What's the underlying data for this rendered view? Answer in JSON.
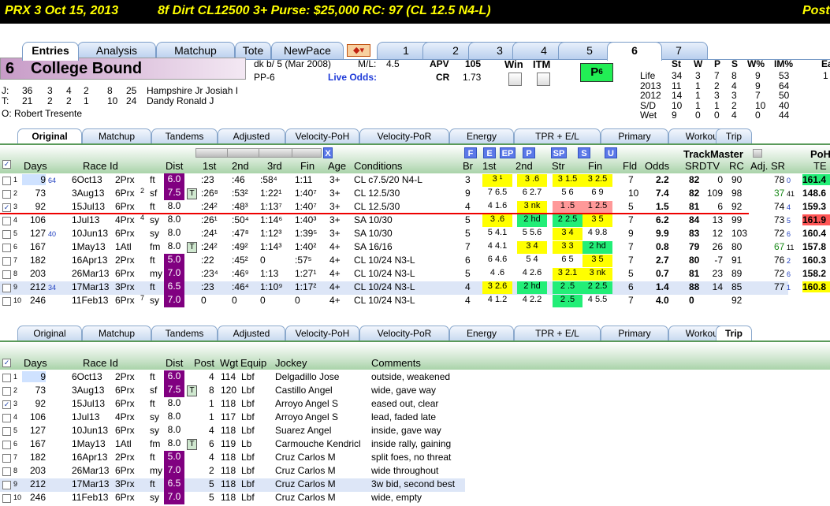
{
  "topbar": {
    "race": "PRX  3   Oct 15, 2013",
    "conditions": "8f  Dirt   CL12500  3+   Purse: $25,000   RC: 97  (CL 12.5 N4-L)",
    "right": "Post"
  },
  "main_tabs": [
    "Entries",
    "Analysis",
    "Matchup",
    "Tote",
    "NewPace",
    "1",
    "2",
    "3",
    "4",
    "5",
    "6",
    "7"
  ],
  "horse": {
    "number": "6",
    "name": "College Bound",
    "breed": "dk b/  5  (Mar 2008)",
    "ml_label": "M/L:",
    "ml": "4.5",
    "pp": "PP-6",
    "live_odds": "Live Odds:",
    "apv_label": "APV",
    "apv": "105",
    "cr_label": "CR",
    "cr": "1.73",
    "win": "Win",
    "itm": "ITM",
    "p_badge": "P",
    "p_sub": "6"
  },
  "jockey": {
    "label": "J:",
    "stats": [
      "36",
      "3",
      "4",
      "2",
      "8",
      "25"
    ],
    "name": "Hampshire Jr Josiah I"
  },
  "trainer": {
    "label": "T:",
    "stats": [
      "21",
      "2",
      "2",
      "1",
      "10",
      "24"
    ],
    "name": "Dandy Ronald J"
  },
  "owner": {
    "label": "O:",
    "name": "Robert Tresente"
  },
  "record": {
    "headers": [
      "St",
      "W",
      "P",
      "S",
      "W%",
      "IM%",
      "Ea"
    ],
    "rows": [
      [
        "Life",
        "34",
        "3",
        "7",
        "8",
        "9",
        "53",
        "1"
      ],
      [
        "2013",
        "11",
        "1",
        "2",
        "4",
        "9",
        "64",
        ""
      ],
      [
        "2012",
        "14",
        "1",
        "3",
        "3",
        "7",
        "50",
        ""
      ],
      [
        "S/D",
        "10",
        "1",
        "1",
        "2",
        "10",
        "40",
        ""
      ],
      [
        "Wet",
        "9",
        "0",
        "0",
        "4",
        "0",
        "44",
        ""
      ]
    ]
  },
  "sub_tabs": [
    "Original",
    "Matchup",
    "Tandems",
    "Adjusted",
    "Velocity-PoH",
    "Velocity-PoR",
    "Energy",
    "TPR + E/L",
    "Primary",
    "Workouts",
    "Trip"
  ],
  "pp_headers": {
    "days": "Days",
    "raceid": "Race Id",
    "dist": "Dist",
    "c1": "1st",
    "c2": "2nd",
    "c3": "3rd",
    "fin": "Fin",
    "age": "Age",
    "cond": "Conditions",
    "br": "Br",
    "first": "1st",
    "second": "2nd",
    "str": "Str",
    "fin2": "Fin",
    "fld": "Fld",
    "odds": "Odds",
    "srdtv": "SRDTV",
    "rc": "RC",
    "trackmaster": "TrackMaster",
    "adj": "Adj. SR",
    "poh": "PoH",
    "te": "TE",
    "btn_f": "F",
    "btn_e": "E",
    "btn_ep": "EP",
    "btn_p": "P",
    "btn_sp": "SP",
    "btn_s": "S",
    "btn_u": "U",
    "btn_x": "X"
  },
  "pp_rows": [
    {
      "n": "1",
      "days": "9",
      "dsub": "64",
      "date": "6Oct13",
      "race": "2Prx",
      "surf": "ft",
      "dist": "6.0",
      "c1": ":23",
      "c2": ":46",
      "c3": ":58⁴",
      "fin": "1:11",
      "age": "3+",
      "cond": "CL c7.5/20 N4-L",
      "br": "3",
      "p1": "3 ¹",
      "p2": "3 .6",
      "str": "3 1.5",
      "fin2": "3 2.5",
      "fld": "7",
      "odds": "2.2",
      "sr": "82",
      "dtv": "0",
      "rc": "90",
      "adj": "78",
      "adjs": "0",
      "te": "161.4",
      "checked": false
    },
    {
      "n": "2",
      "days": "73",
      "dsub": "",
      "date": "3Aug13",
      "race": "6Prx",
      "surf": "sf",
      "sup": "2",
      "dist": "7.5",
      "t": true,
      "c1": ":26⁸",
      "c2": ":53²",
      "c3": "1:22¹",
      "fin": "1:40⁷",
      "age": "3+",
      "cond": "CL 12.5/30",
      "br": "9",
      "p1": "7 6.5",
      "p2": "6 2.7",
      "str": "5 6",
      "fin2": "6 9",
      "fld": "10",
      "odds": "7.4",
      "sr": "82",
      "dtv": "109",
      "rc": "98",
      "adj": "37",
      "adj2": "41",
      "te": "148.6",
      "checked": false
    },
    {
      "n": "3",
      "days": "92",
      "dsub": "",
      "date": "15Jul13",
      "race": "6Prx",
      "surf": "ft",
      "dist": "8.0",
      "c1": ":24²",
      "c2": ":48³",
      "c3": "1:13⁷",
      "fin": "1:40⁷",
      "age": "3+",
      "cond": "CL 12.5/30",
      "br": "4",
      "p1": "4 1.6",
      "p2": "3 nk",
      "str": "1 .5",
      "fin2": "1 2.5",
      "fld": "5",
      "odds": "1.5",
      "sr": "81",
      "dtv": "6",
      "rc": "92",
      "adj": "74",
      "adjs": "4",
      "te": "159.3",
      "checked": true
    },
    {
      "n": "4",
      "days": "106",
      "dsub": "",
      "date": "1Jul13",
      "race": "4Prx",
      "surf": "sy",
      "sup": "4",
      "dist": "8.0",
      "c1": ":26¹",
      "c2": ":50⁴",
      "c3": "1:14⁶",
      "fin": "1:40³",
      "age": "3+",
      "cond": "SA 10/30",
      "br": "5",
      "p1": "3 .6",
      "p2": "2 hd",
      "str": "2 2.5",
      "fin2": "3 5",
      "fld": "7",
      "odds": "6.2",
      "sr": "84",
      "dtv": "13",
      "rc": "99",
      "adj": "73",
      "adjs": "5",
      "te": "161.9",
      "checked": false
    },
    {
      "n": "5",
      "days": "127",
      "dsub": "40",
      "date": "10Jun13",
      "race": "6Prx",
      "surf": "sy",
      "dist": "8.0",
      "c1": ":24¹",
      "c2": ":47⁸",
      "c3": "1:12³",
      "fin": "1:39⁵",
      "age": "3+",
      "cond": "SA 10/30",
      "br": "5",
      "p1": "5 4.1",
      "p2": "5 5.6",
      "str": "3 4",
      "fin2": "4 9.8",
      "fld": "9",
      "odds": "9.9",
      "sr": "83",
      "dtv": "12",
      "rc": "103",
      "adj": "72",
      "adjs": "6",
      "te": "160.4",
      "checked": false
    },
    {
      "n": "6",
      "days": "167",
      "dsub": "",
      "date": "1May13",
      "race": "1Atl",
      "surf": "fm",
      "dist": "8.0",
      "t": true,
      "c1": ":24²",
      "c2": ":49²",
      "c3": "1:14³",
      "fin": "1:40²",
      "age": "4+",
      "cond": "SA 16/16",
      "br": "7",
      "p1": "4 4.1",
      "p2": "3 4",
      "str": "3 3",
      "fin2": "2 hd",
      "fld": "7",
      "odds": "0.8",
      "sr": "79",
      "dtv": "26",
      "rc": "80",
      "adj": "67",
      "adj2": "11",
      "te": "157.8",
      "checked": false
    },
    {
      "n": "7",
      "days": "182",
      "dsub": "",
      "date": "16Apr13",
      "race": "2Prx",
      "surf": "ft",
      "dist": "5.0",
      "c1": ":22",
      "c2": ":45²",
      "c3": "0",
      "fin": ":57⁵",
      "age": "4+",
      "cond": "CL 10/24 N3-L",
      "br": "6",
      "p1": "6 4.6",
      "p2": "5 4",
      "str": "6 5",
      "fin2": "3 5",
      "fld": "7",
      "odds": "2.7",
      "sr": "80",
      "dtv": "-7",
      "rc": "91",
      "adj": "76",
      "adjs": "2",
      "te": "160.3",
      "checked": false
    },
    {
      "n": "8",
      "days": "203",
      "dsub": "",
      "date": "26Mar13",
      "race": "6Prx",
      "surf": "my",
      "dist": "7.0",
      "c1": ":23⁴",
      "c2": ":46⁹",
      "c3": "1:13",
      "fin": "1:27¹",
      "age": "4+",
      "cond": "CL 10/24 N3-L",
      "br": "5",
      "p1": "4 .6",
      "p2": "4 2.6",
      "str": "3 2.1",
      "fin2": "3 nk",
      "fld": "5",
      "odds": "0.7",
      "sr": "81",
      "dtv": "23",
      "rc": "89",
      "adj": "72",
      "adjs": "6",
      "te": "158.2",
      "checked": false
    },
    {
      "n": "9",
      "days": "212",
      "dsub": "34",
      "date": "17Mar13",
      "race": "3Prx",
      "surf": "ft",
      "dist": "6.5",
      "c1": ":23",
      "c2": ":46⁴",
      "c3": "1:10⁹",
      "fin": "1:17²",
      "age": "4+",
      "cond": "CL 10/24 N3-L",
      "br": "4",
      "p1": "3 2.6",
      "p2": "2 hd",
      "str": "2 .5",
      "fin2": "2 2.5",
      "fld": "6",
      "odds": "1.4",
      "sr": "88",
      "dtv": "14",
      "rc": "85",
      "adj": "77",
      "adjs": "1",
      "te": "160.8",
      "checked": false
    },
    {
      "n": "10",
      "days": "246",
      "dsub": "",
      "date": "11Feb13",
      "race": "6Prx",
      "surf": "sy",
      "sup": "7",
      "dist": "7.0",
      "c1": "0",
      "c2": "0",
      "c3": "0",
      "fin": "0",
      "age": "4+",
      "cond": "CL 10/24 N3-L",
      "br": "4",
      "p1": "4 1.2",
      "p2": "4 2.2",
      "str": "2 .5",
      "fin2": "4 5.5",
      "fld": "7",
      "odds": "4.0",
      "sr": "0",
      "dtv": "",
      "rc": "92",
      "adj": "",
      "adjs": "",
      "te": "",
      "checked": false
    }
  ],
  "trip_headers": {
    "days": "Days",
    "raceid": "Race Id",
    "dist": "Dist",
    "post": "Post",
    "wgt": "Wgt",
    "equip": "Equip",
    "jockey": "Jockey",
    "comments": "Comments"
  },
  "trip_rows": [
    {
      "n": "1",
      "days": "9",
      "date": "6Oct13",
      "race": "2Prx",
      "surf": "ft",
      "dist": "6.0",
      "post": "4",
      "wgt": "114",
      "equip": "Lbf",
      "jockey": "Delgadillo Jose",
      "comment": "outside, weakened"
    },
    {
      "n": "2",
      "days": "73",
      "date": "3Aug13",
      "race": "6Prx",
      "surf": "sf",
      "dist": "7.5",
      "t": true,
      "post": "8",
      "wgt": "120",
      "equip": "Lbf",
      "jockey": "Castillo Angel",
      "comment": "wide, gave way"
    },
    {
      "n": "3",
      "days": "92",
      "date": "15Jul13",
      "race": "6Prx",
      "surf": "ft",
      "dist": "8.0",
      "post": "1",
      "wgt": "118",
      "equip": "Lbf",
      "jockey": "Arroyo Angel S",
      "comment": "eased out, clear"
    },
    {
      "n": "4",
      "days": "106",
      "date": "1Jul13",
      "race": "4Prx",
      "surf": "sy",
      "dist": "8.0",
      "post": "1",
      "wgt": "117",
      "equip": "Lbf",
      "jockey": "Arroyo Angel S",
      "comment": "lead, faded late"
    },
    {
      "n": "5",
      "days": "127",
      "date": "10Jun13",
      "race": "6Prx",
      "surf": "sy",
      "dist": "8.0",
      "post": "4",
      "wgt": "118",
      "equip": "Lbf",
      "jockey": "Suarez Angel",
      "comment": "inside, gave way"
    },
    {
      "n": "6",
      "days": "167",
      "date": "1May13",
      "race": "1Atl",
      "surf": "fm",
      "dist": "8.0",
      "t": true,
      "post": "6",
      "wgt": "119",
      "equip": "Lb",
      "jockey": "Carmouche Kendricl",
      "comment": "inside rally, gaining"
    },
    {
      "n": "7",
      "days": "182",
      "date": "16Apr13",
      "race": "2Prx",
      "surf": "ft",
      "dist": "5.0",
      "post": "4",
      "wgt": "118",
      "equip": "Lbf",
      "jockey": "Cruz Carlos M",
      "comment": "split foes, no threat"
    },
    {
      "n": "8",
      "days": "203",
      "date": "26Mar13",
      "race": "6Prx",
      "surf": "my",
      "dist": "7.0",
      "post": "2",
      "wgt": "118",
      "equip": "Lbf",
      "jockey": "Cruz Carlos M",
      "comment": "wide throughout"
    },
    {
      "n": "9",
      "days": "212",
      "date": "17Mar13",
      "race": "3Prx",
      "surf": "ft",
      "dist": "6.5",
      "post": "5",
      "wgt": "118",
      "equip": "Lbf",
      "jockey": "Cruz Carlos M",
      "comment": "3w bid, second best"
    },
    {
      "n": "10",
      "days": "246",
      "date": "11Feb13",
      "race": "6Prx",
      "surf": "sy",
      "dist": "7.0",
      "post": "5",
      "wgt": "118",
      "equip": "Lbf",
      "jockey": "Cruz Carlos M",
      "comment": "wide, empty"
    }
  ],
  "colors": {
    "topbar_bg": "#000000",
    "topbar_fg": "#ffff00",
    "dist_bg": "#800080",
    "highlight_yellow": "#ffff00",
    "highlight_green": "#22ee77",
    "highlight_red": "#ff5555",
    "name_bg": "#c9a0c9"
  }
}
